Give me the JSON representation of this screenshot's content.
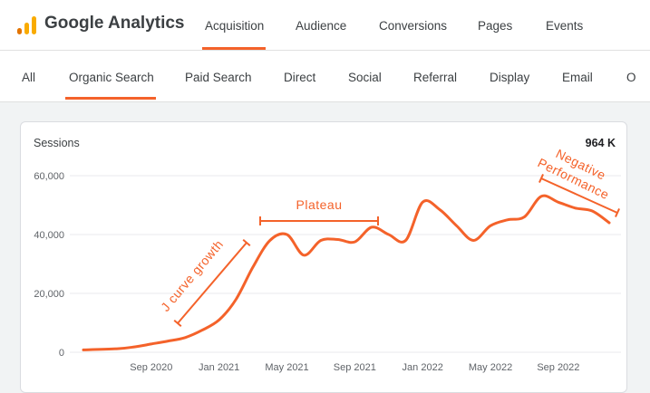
{
  "header": {
    "brand": "Google Analytics",
    "tabs": [
      {
        "label": "Acquisition",
        "active": true
      },
      {
        "label": "Audience",
        "active": false
      },
      {
        "label": "Conversions",
        "active": false
      },
      {
        "label": "Pages",
        "active": false
      },
      {
        "label": "Events",
        "active": false
      }
    ]
  },
  "subnav": {
    "tabs": [
      {
        "label": "All",
        "active": false
      },
      {
        "label": "Organic Search",
        "active": true
      },
      {
        "label": "Paid Search",
        "active": false
      },
      {
        "label": "Direct",
        "active": false
      },
      {
        "label": "Social",
        "active": false
      },
      {
        "label": "Referral",
        "active": false
      },
      {
        "label": "Display",
        "active": false
      },
      {
        "label": "Email",
        "active": false
      },
      {
        "label": "O",
        "active": false
      }
    ]
  },
  "card": {
    "title": "Sessions",
    "total": "964 K"
  },
  "colors": {
    "accent": "#f4622a",
    "logo_orange": "#f9ab00",
    "logo_dark": "#e37400"
  },
  "icons": {
    "logo": "analytics-bars-icon"
  },
  "chart_data": {
    "type": "line",
    "title": "Sessions",
    "ylim": [
      0,
      60000
    ],
    "yticks": [
      "0",
      "20,000",
      "40,000",
      "60,000"
    ],
    "xticks": [
      "Sep 2020",
      "Jan 2021",
      "May 2021",
      "Sep 2021",
      "Jan 2022",
      "May 2022",
      "Sep 2022"
    ],
    "grid": true,
    "series": [
      {
        "values": [
          {
            "x": "2020-05",
            "y": 800
          },
          {
            "x": "2020-07",
            "y": 1200
          },
          {
            "x": "2020-08",
            "y": 1800
          },
          {
            "x": "2020-09",
            "y": 2800
          },
          {
            "x": "2020-10",
            "y": 3800
          },
          {
            "x": "2020-11",
            "y": 5000
          },
          {
            "x": "2020-12",
            "y": 7500
          },
          {
            "x": "2021-01",
            "y": 11000
          },
          {
            "x": "2021-02",
            "y": 18000
          },
          {
            "x": "2021-03",
            "y": 29000
          },
          {
            "x": "2021-04",
            "y": 38000
          },
          {
            "x": "2021-05",
            "y": 40000
          },
          {
            "x": "2021-06",
            "y": 33000
          },
          {
            "x": "2021-07",
            "y": 38000
          },
          {
            "x": "2021-08",
            "y": 38300
          },
          {
            "x": "2021-09",
            "y": 37500
          },
          {
            "x": "2021-10",
            "y": 42500
          },
          {
            "x": "2021-11",
            "y": 40000
          },
          {
            "x": "2021-12",
            "y": 38000
          },
          {
            "x": "2022-01",
            "y": 51000
          },
          {
            "x": "2022-02",
            "y": 48500
          },
          {
            "x": "2022-03",
            "y": 43000
          },
          {
            "x": "2022-04",
            "y": 38000
          },
          {
            "x": "2022-05",
            "y": 43000
          },
          {
            "x": "2022-06",
            "y": 45000
          },
          {
            "x": "2022-07",
            "y": 46000
          },
          {
            "x": "2022-08",
            "y": 53000
          },
          {
            "x": "2022-09",
            "y": 51000
          },
          {
            "x": "2022-10",
            "y": 49000
          },
          {
            "x": "2022-11",
            "y": 48000
          },
          {
            "x": "2022-12",
            "y": 44000
          }
        ]
      }
    ],
    "annotations": [
      {
        "text": "J curve growth",
        "from": "2020-12",
        "to": "2021-04"
      },
      {
        "text": "Plateau",
        "from": "2021-05",
        "to": "2021-10"
      },
      {
        "text": "Negative Performance",
        "from": "2022-08",
        "to": "2022-12"
      }
    ]
  }
}
